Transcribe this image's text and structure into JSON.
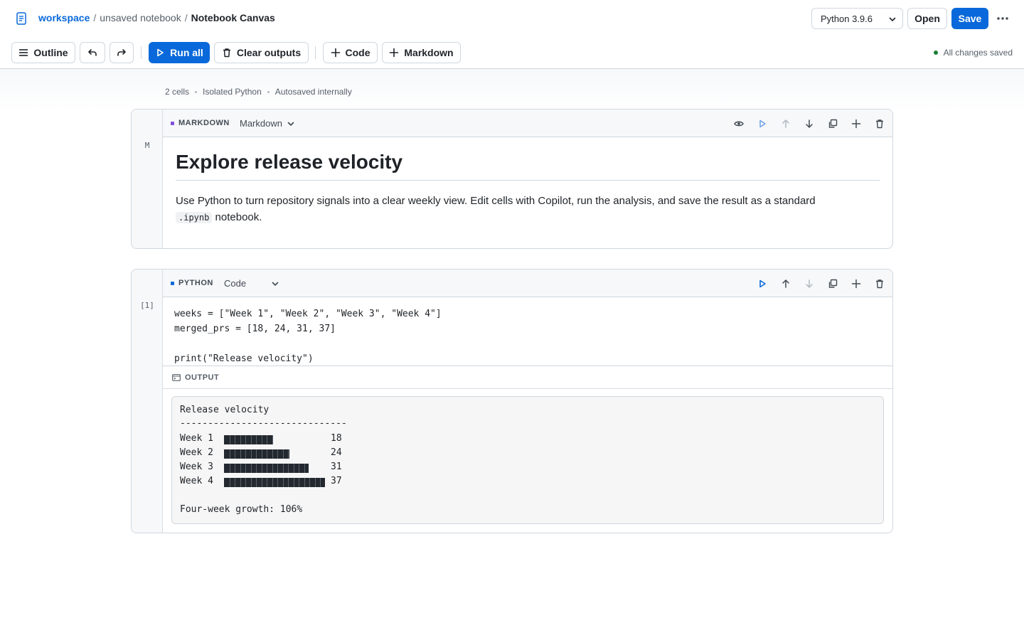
{
  "header": {
    "breadcrumb": {
      "workspace": "workspace",
      "separator": "/",
      "middle": "unsaved notebook",
      "current": "Notebook Canvas"
    },
    "kernel": "Python 3.9.6",
    "open_label": "Open",
    "save_label": "Save"
  },
  "toolbar": {
    "outline_label": "Outline",
    "run_all_label": "Run all",
    "clear_outputs_label": "Clear outputs",
    "code_label": "Code",
    "markdown_label": "Markdown",
    "status": "All changes saved"
  },
  "meta": {
    "cells": "2 cells",
    "runtime": "Isolated Python",
    "autosave": "Autosaved internally"
  },
  "cells": [
    {
      "gutter": "M",
      "type_label": "MARKDOWN",
      "type_select": "Markdown",
      "title": "Explore release velocity",
      "para_before": "Use Python to turn repository signals into a clear weekly view. Edit cells with Copilot, run the analysis, and save the result as a standard ",
      "para_code": ".ipynb",
      "para_after": " notebook."
    },
    {
      "gutter": "[1]",
      "type_label": "PYTHON",
      "type_select": "Code",
      "code_lines": [
        "weeks = [\"Week 1\", \"Week 2\", \"Week 3\", \"Week 4\"]",
        "merged_prs = [18, 24, 31, 37]",
        "",
        "print(\"Release velocity\")"
      ],
      "output_label": "OUTPUT",
      "output": {
        "title": "Release velocity",
        "rule": "------------------------------",
        "rows": [
          {
            "label": "Week 1",
            "value": 18
          },
          {
            "label": "Week 2",
            "value": 24
          },
          {
            "label": "Week 3",
            "value": 31
          },
          {
            "label": "Week 4",
            "value": 37
          }
        ],
        "growth": "Four-week growth: 106%"
      }
    }
  ],
  "colors": {
    "accent": "#0969da",
    "markdown_dot": "#8250df",
    "python_dot": "#0969da",
    "saved_dot": "#1a7f37",
    "bar": "#24292f"
  }
}
